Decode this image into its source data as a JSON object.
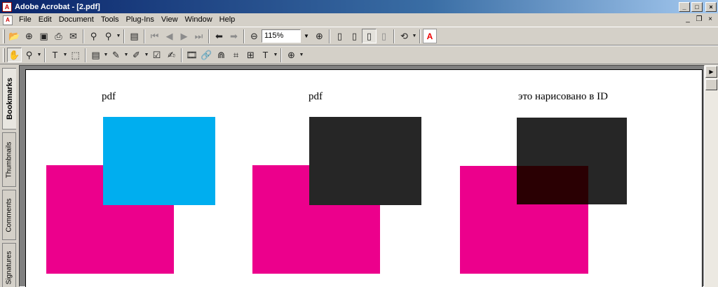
{
  "window": {
    "title": "Adobe Acrobat - [2.pdf]",
    "app_icon": "pdf-icon",
    "buttons": {
      "minimize": "_",
      "maximize": "□",
      "close": "×"
    }
  },
  "menubar": {
    "items": [
      "File",
      "Edit",
      "Document",
      "Tools",
      "Plug-Ins",
      "View",
      "Window",
      "Help"
    ],
    "doc_buttons": {
      "minimize": "_",
      "restore": "❐",
      "close": "×"
    }
  },
  "toolbar": {
    "zoom_value": "115%",
    "adobe_logo": "A"
  },
  "nav_tabs": [
    "Bookmarks",
    "Thumbnails",
    "Comments",
    "Signatures"
  ],
  "page": {
    "labels": [
      "pdf",
      "pdf",
      "это нарисовано в ID"
    ],
    "colors": {
      "magenta": "#ec008c",
      "cyan": "#00aeef",
      "black": "#262626",
      "overlap_dark": "#2a0003"
    }
  }
}
